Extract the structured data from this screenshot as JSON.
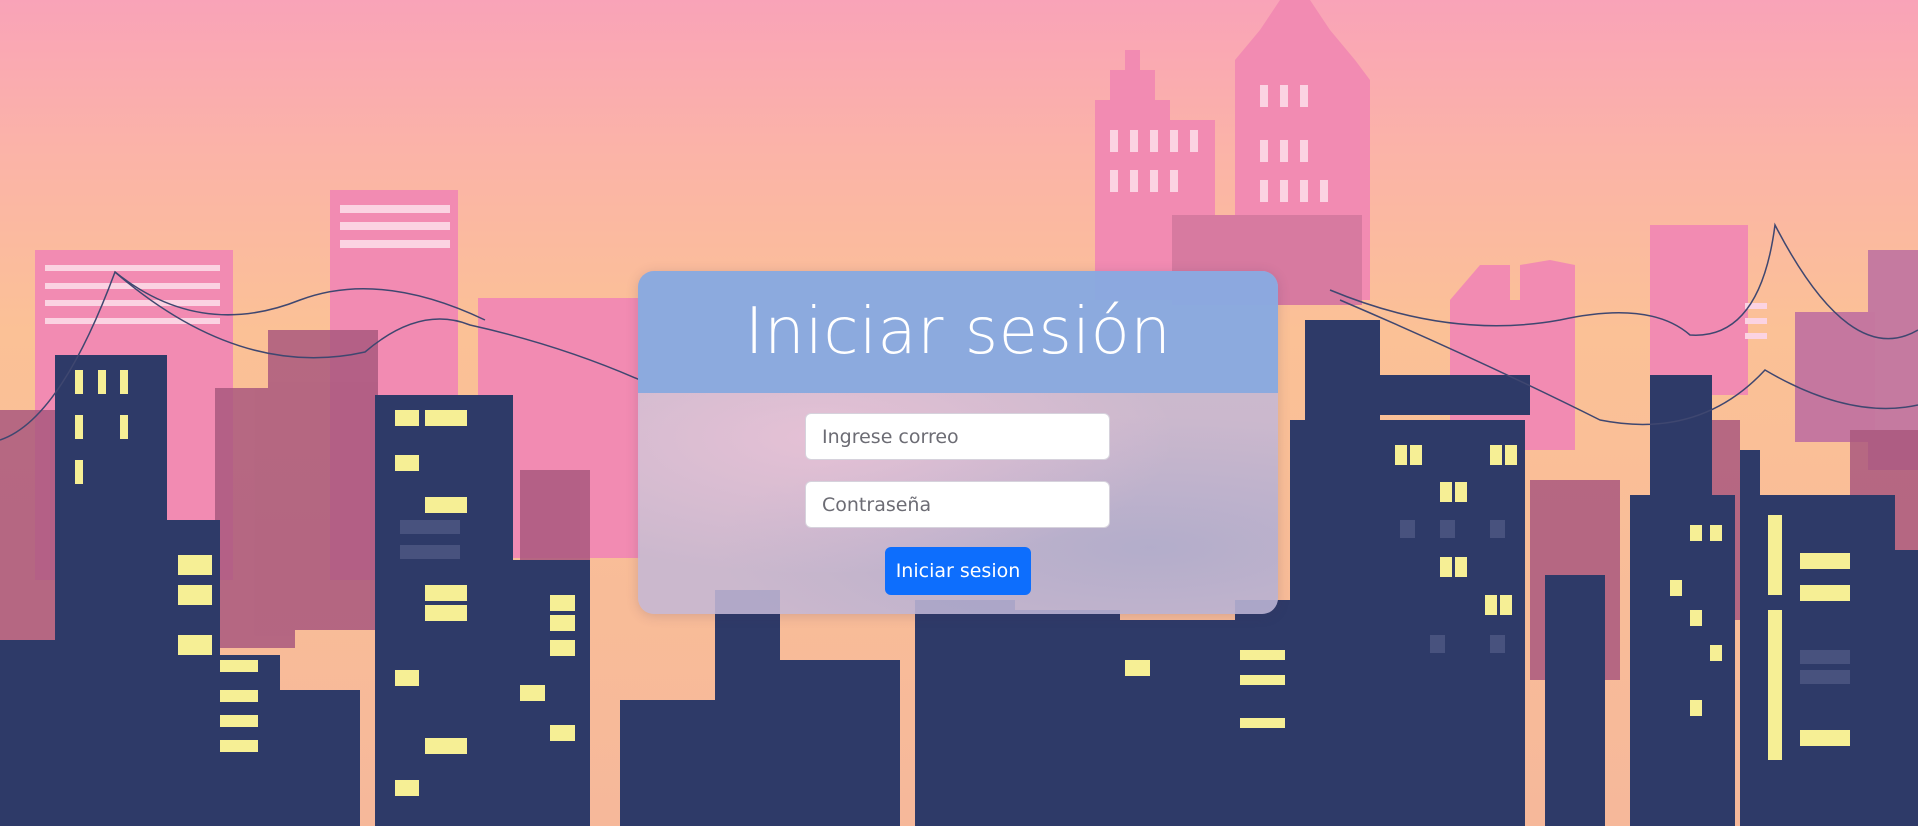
{
  "login": {
    "title": "Iniciar sesión",
    "email_placeholder": "Ingrese correo",
    "password_placeholder": "Contraseña",
    "submit_label": "Iniciar sesion"
  },
  "colors": {
    "accent": "#0d6efd",
    "header": "#87a8e1",
    "sky_top": "#f9a3b8",
    "sky_bottom": "#fbbf93",
    "building_front": "#2e3a68",
    "window_lit": "#f6ef95"
  }
}
